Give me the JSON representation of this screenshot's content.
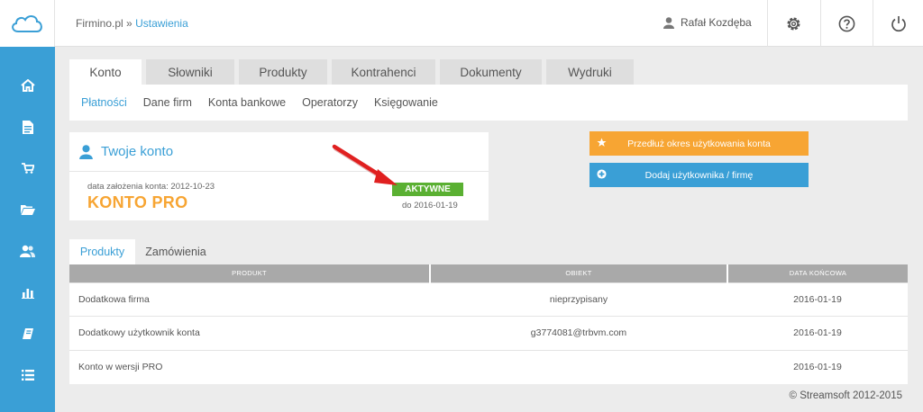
{
  "topbar": {
    "breadcrumb_root": "Firmino.pl",
    "breadcrumb_sep": "»",
    "breadcrumb_current": "Ustawienia",
    "user_name": "Rafał Kozdęba"
  },
  "sidebar": {
    "items": [
      {
        "icon": "home-icon"
      },
      {
        "icon": "document-icon"
      },
      {
        "icon": "cart-icon"
      },
      {
        "icon": "folder-icon"
      },
      {
        "icon": "contacts-icon"
      },
      {
        "icon": "chart-icon"
      },
      {
        "icon": "book-icon"
      },
      {
        "icon": "list-icon"
      }
    ]
  },
  "tabs": [
    "Konto",
    "Słowniki",
    "Produkty",
    "Kontrahenci",
    "Dokumenty",
    "Wydruki"
  ],
  "subnav": [
    "Płatności",
    "Dane firm",
    "Konta bankowe",
    "Operatorzy",
    "Księgowanie"
  ],
  "account": {
    "title": "Twoje konto",
    "created": "data założenia konta: 2012-10-23",
    "plan": "KONTO PRO",
    "status": "AKTYWNE",
    "valid_until": "do 2016-01-19"
  },
  "actions": {
    "extend": "Przedłuż okres użytkowania konta",
    "add_user": "Dodaj użytkownika / firmę"
  },
  "product_tabs": [
    "Produkty",
    "Zamówienia"
  ],
  "table": {
    "headers": [
      "PRODUKT",
      "OBIEKT",
      "DATA KOŃCOWA"
    ],
    "rows": [
      [
        "Dodatkowa firma",
        "nieprzypisany",
        "2016-01-19"
      ],
      [
        "Dodatkowy użytkownik konta",
        "g3774081@trbvm.com",
        "2016-01-19"
      ],
      [
        "Konto w wersji PRO",
        "",
        "2016-01-19"
      ]
    ]
  },
  "footer": "© Streamsoft 2012-2015",
  "colors": {
    "primary": "#3a9fd6",
    "accent_orange": "#f7a533",
    "status_green": "#5ab032",
    "annotation_red": "#e02020"
  }
}
